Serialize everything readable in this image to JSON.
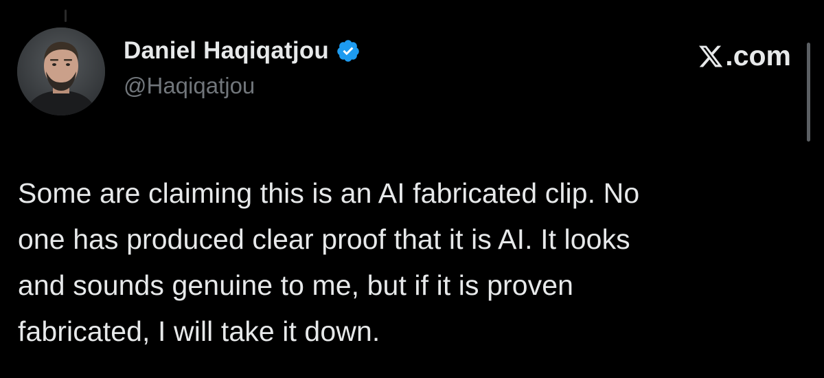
{
  "author": {
    "display_name": "Daniel Haqiqatjou",
    "handle": "@Haqiqatjou",
    "verified": true,
    "verified_badge_color": "#1d9bf0"
  },
  "brand": {
    "label": ".com",
    "logo_icon": "x-logo-icon"
  },
  "tweet": {
    "text": "Some are claiming this is an AI fabricated clip. No\none has produced clear proof that it is AI. It looks\nand sounds genuine to me, but if it is proven\nfabricated, I will take it down."
  },
  "colors": {
    "background": "#000000",
    "primary_text": "#e7e9ea",
    "secondary_text": "#71767b"
  }
}
